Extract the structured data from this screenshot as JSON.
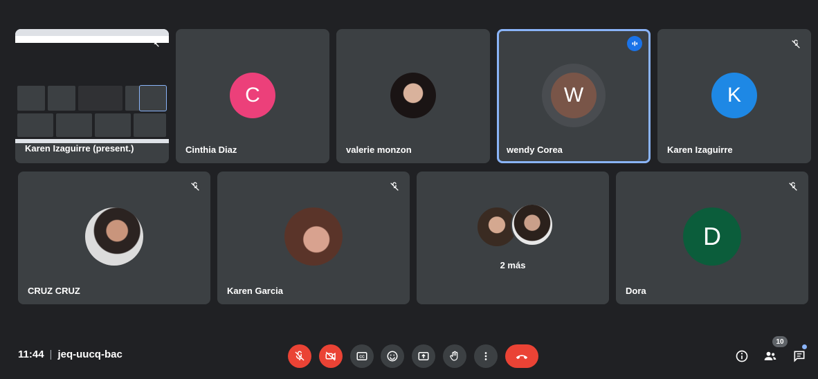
{
  "meeting": {
    "time": "11:44",
    "separator": "|",
    "code": "jeq-uucq-bac"
  },
  "tiles": {
    "presenter": {
      "name": "Karen Izaguirre (present.)"
    },
    "cinthia": {
      "name": "Cinthia Diaz",
      "initial": "C",
      "color": "#ec407a"
    },
    "valerie": {
      "name": "valerie monzon"
    },
    "wendy": {
      "name": "wendy Corea",
      "initial": "W",
      "color": "#795548"
    },
    "karen_i": {
      "name": "Karen Izaguirre",
      "initial": "K",
      "color": "#1e88e5"
    },
    "cruz": {
      "name": "CRUZ CRUZ"
    },
    "karen_g": {
      "name": "Karen Garcia"
    },
    "more": {
      "label": "2 más"
    },
    "dora": {
      "name": "Dora",
      "initial": "D",
      "color": "#0b5d3b"
    }
  },
  "controls": {
    "participants_count": "10"
  },
  "icons": [
    "mic-off-icon",
    "camera-off-icon",
    "captions-icon",
    "emoji-icon",
    "present-icon",
    "raise-hand-icon",
    "more-options-icon",
    "hang-up-icon",
    "info-icon",
    "people-icon",
    "chat-icon"
  ]
}
